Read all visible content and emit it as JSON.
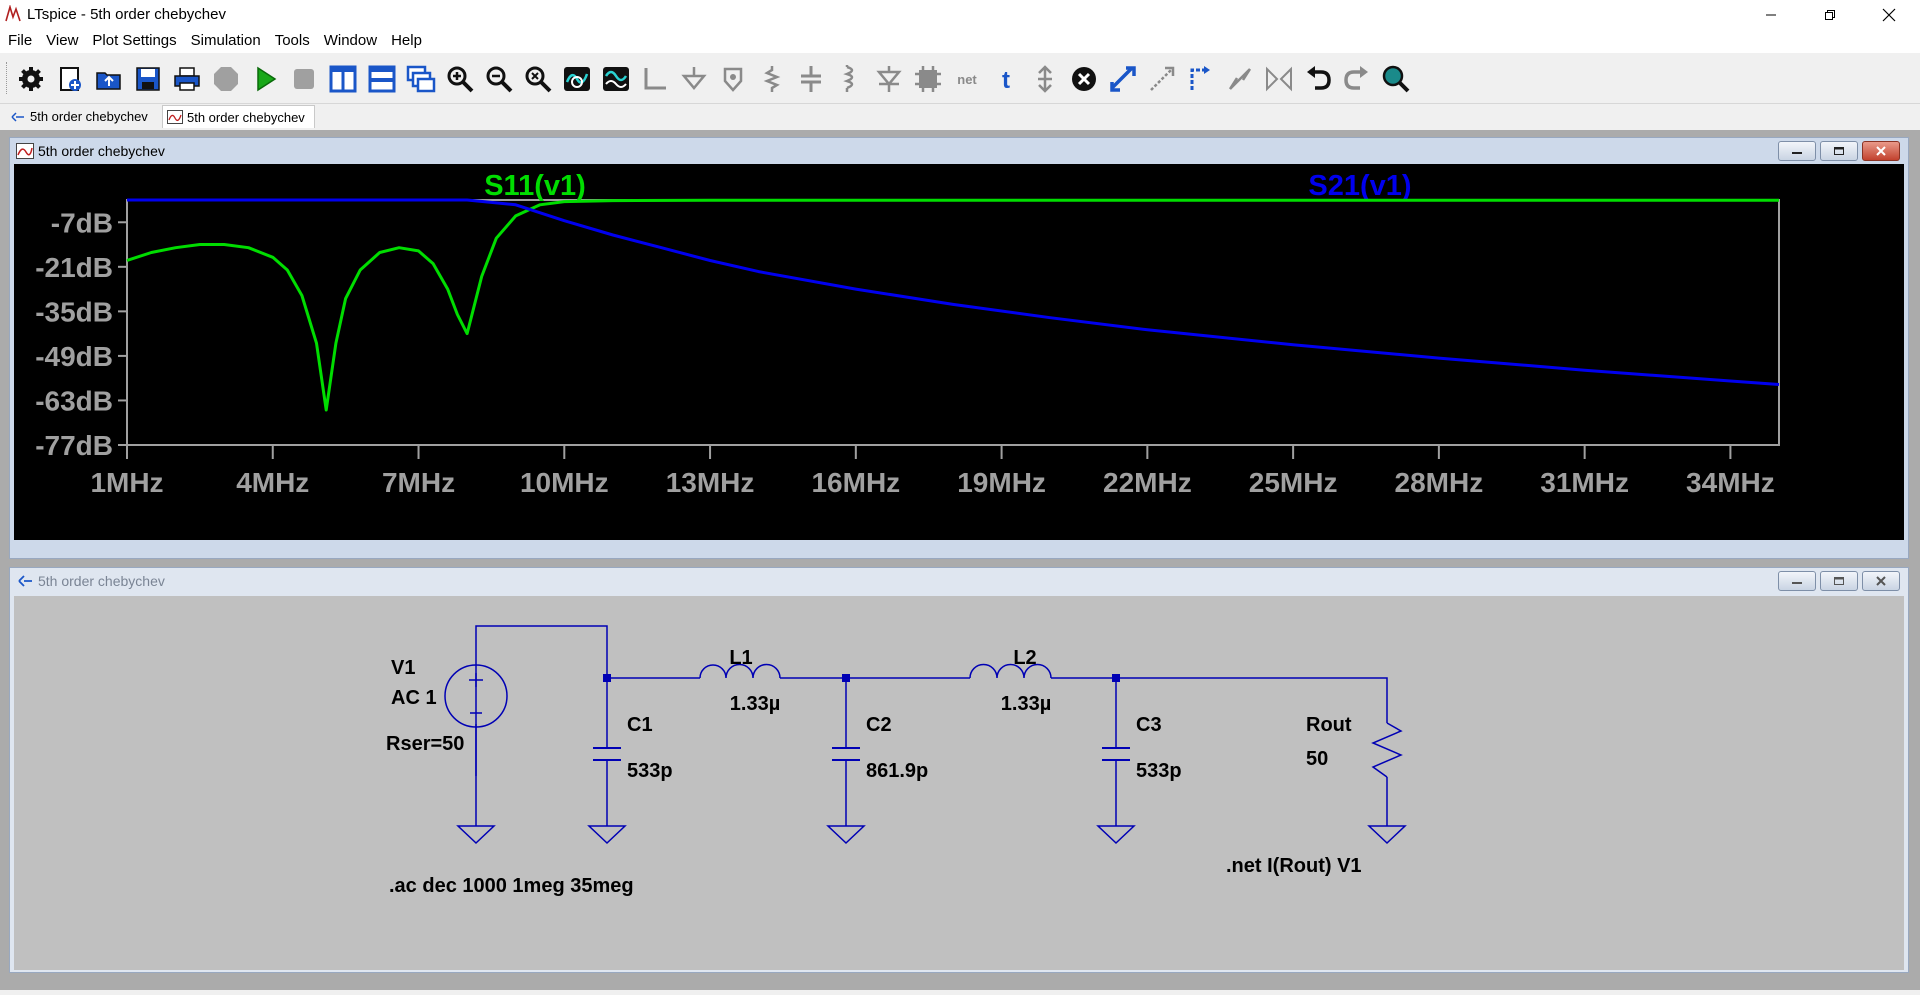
{
  "window": {
    "title": "LTspice - 5th order chebychev"
  },
  "menu": [
    "File",
    "View",
    "Plot Settings",
    "Simulation",
    "Tools",
    "Window",
    "Help"
  ],
  "tabs": [
    {
      "label": "5th order chebychev",
      "kind": "schematic"
    },
    {
      "label": "5th order chebychev",
      "kind": "waveform"
    }
  ],
  "plot_window": {
    "title": "5th order chebychev",
    "traces": [
      {
        "name": "S11(v1)",
        "color": "#00dd00"
      },
      {
        "name": "S21(v1)",
        "color": "#0000ee"
      }
    ],
    "y_ticks": [
      "-7dB",
      "-21dB",
      "-35dB",
      "-49dB",
      "-63dB",
      "-77dB"
    ],
    "x_ticks": [
      "1MHz",
      "4MHz",
      "7MHz",
      "10MHz",
      "13MHz",
      "16MHz",
      "19MHz",
      "22MHz",
      "25MHz",
      "28MHz",
      "31MHz",
      "34MHz"
    ]
  },
  "chart_data": {
    "type": "line",
    "title": "",
    "xlabel": "",
    "ylabel": "",
    "xlim": [
      1,
      35
    ],
    "x_unit": "MHz",
    "ylim": [
      -77,
      0
    ],
    "y_unit": "dB",
    "grid": false,
    "legend": "top",
    "series": [
      {
        "name": "S11(v1)",
        "color": "#00dd00",
        "x": [
          1,
          1.5,
          2,
          2.5,
          3,
          3.5,
          4,
          4.3,
          4.6,
          4.9,
          5.1,
          5.3,
          5.5,
          5.8,
          6.2,
          6.6,
          7,
          7.3,
          7.6,
          7.8,
          8.0,
          8.1,
          8.3,
          8.6,
          9,
          9.5,
          10,
          11,
          13,
          16,
          20,
          25,
          30,
          35
        ],
        "y": [
          -19,
          -16.5,
          -15,
          -14,
          -14,
          -15,
          -18,
          -22,
          -30,
          -45,
          -66,
          -45,
          -31,
          -22,
          -16.5,
          -15,
          -16,
          -20,
          -28,
          -36,
          -42,
          -36,
          -24,
          -12,
          -5,
          -1.5,
          -0.5,
          -0.2,
          -0.1,
          -0.1,
          -0.1,
          -0.1,
          -0.1,
          -0.1
        ]
      },
      {
        "name": "S21(v1)",
        "color": "#0000ee",
        "x": [
          1,
          3,
          5,
          7,
          8,
          9,
          10,
          11,
          12,
          13,
          14,
          16,
          18,
          20,
          22,
          25,
          28,
          31,
          34,
          35
        ],
        "y": [
          0,
          0,
          0,
          0,
          0,
          -1.5,
          -6.5,
          -11,
          -15,
          -19,
          -22.5,
          -28,
          -32.8,
          -37,
          -40.8,
          -45.5,
          -49.7,
          -53.5,
          -56.9,
          -58
        ]
      }
    ]
  },
  "schematic_window": {
    "title": "5th order chebychev",
    "components": {
      "v1_name": "V1",
      "v1_value": "AC 1",
      "v1_rser": "Rser=50",
      "c1_name": "C1",
      "c1_value": "533p",
      "l1_name": "L1",
      "l1_value": "1.33µ",
      "c2_name": "C2",
      "c2_value": "861.9p",
      "l2_name": "L2",
      "l2_value": "1.33µ",
      "c3_name": "C3",
      "c3_value": "533p",
      "rout_name": "Rout",
      "rout_value": "50"
    },
    "directives": {
      "ac": ".ac dec 1000 1meg 35meg",
      "net": ".net I(Rout) V1"
    },
    "colors": {
      "wire": "#0000b4",
      "text": "#000000",
      "background": "#c0c0c0"
    }
  }
}
